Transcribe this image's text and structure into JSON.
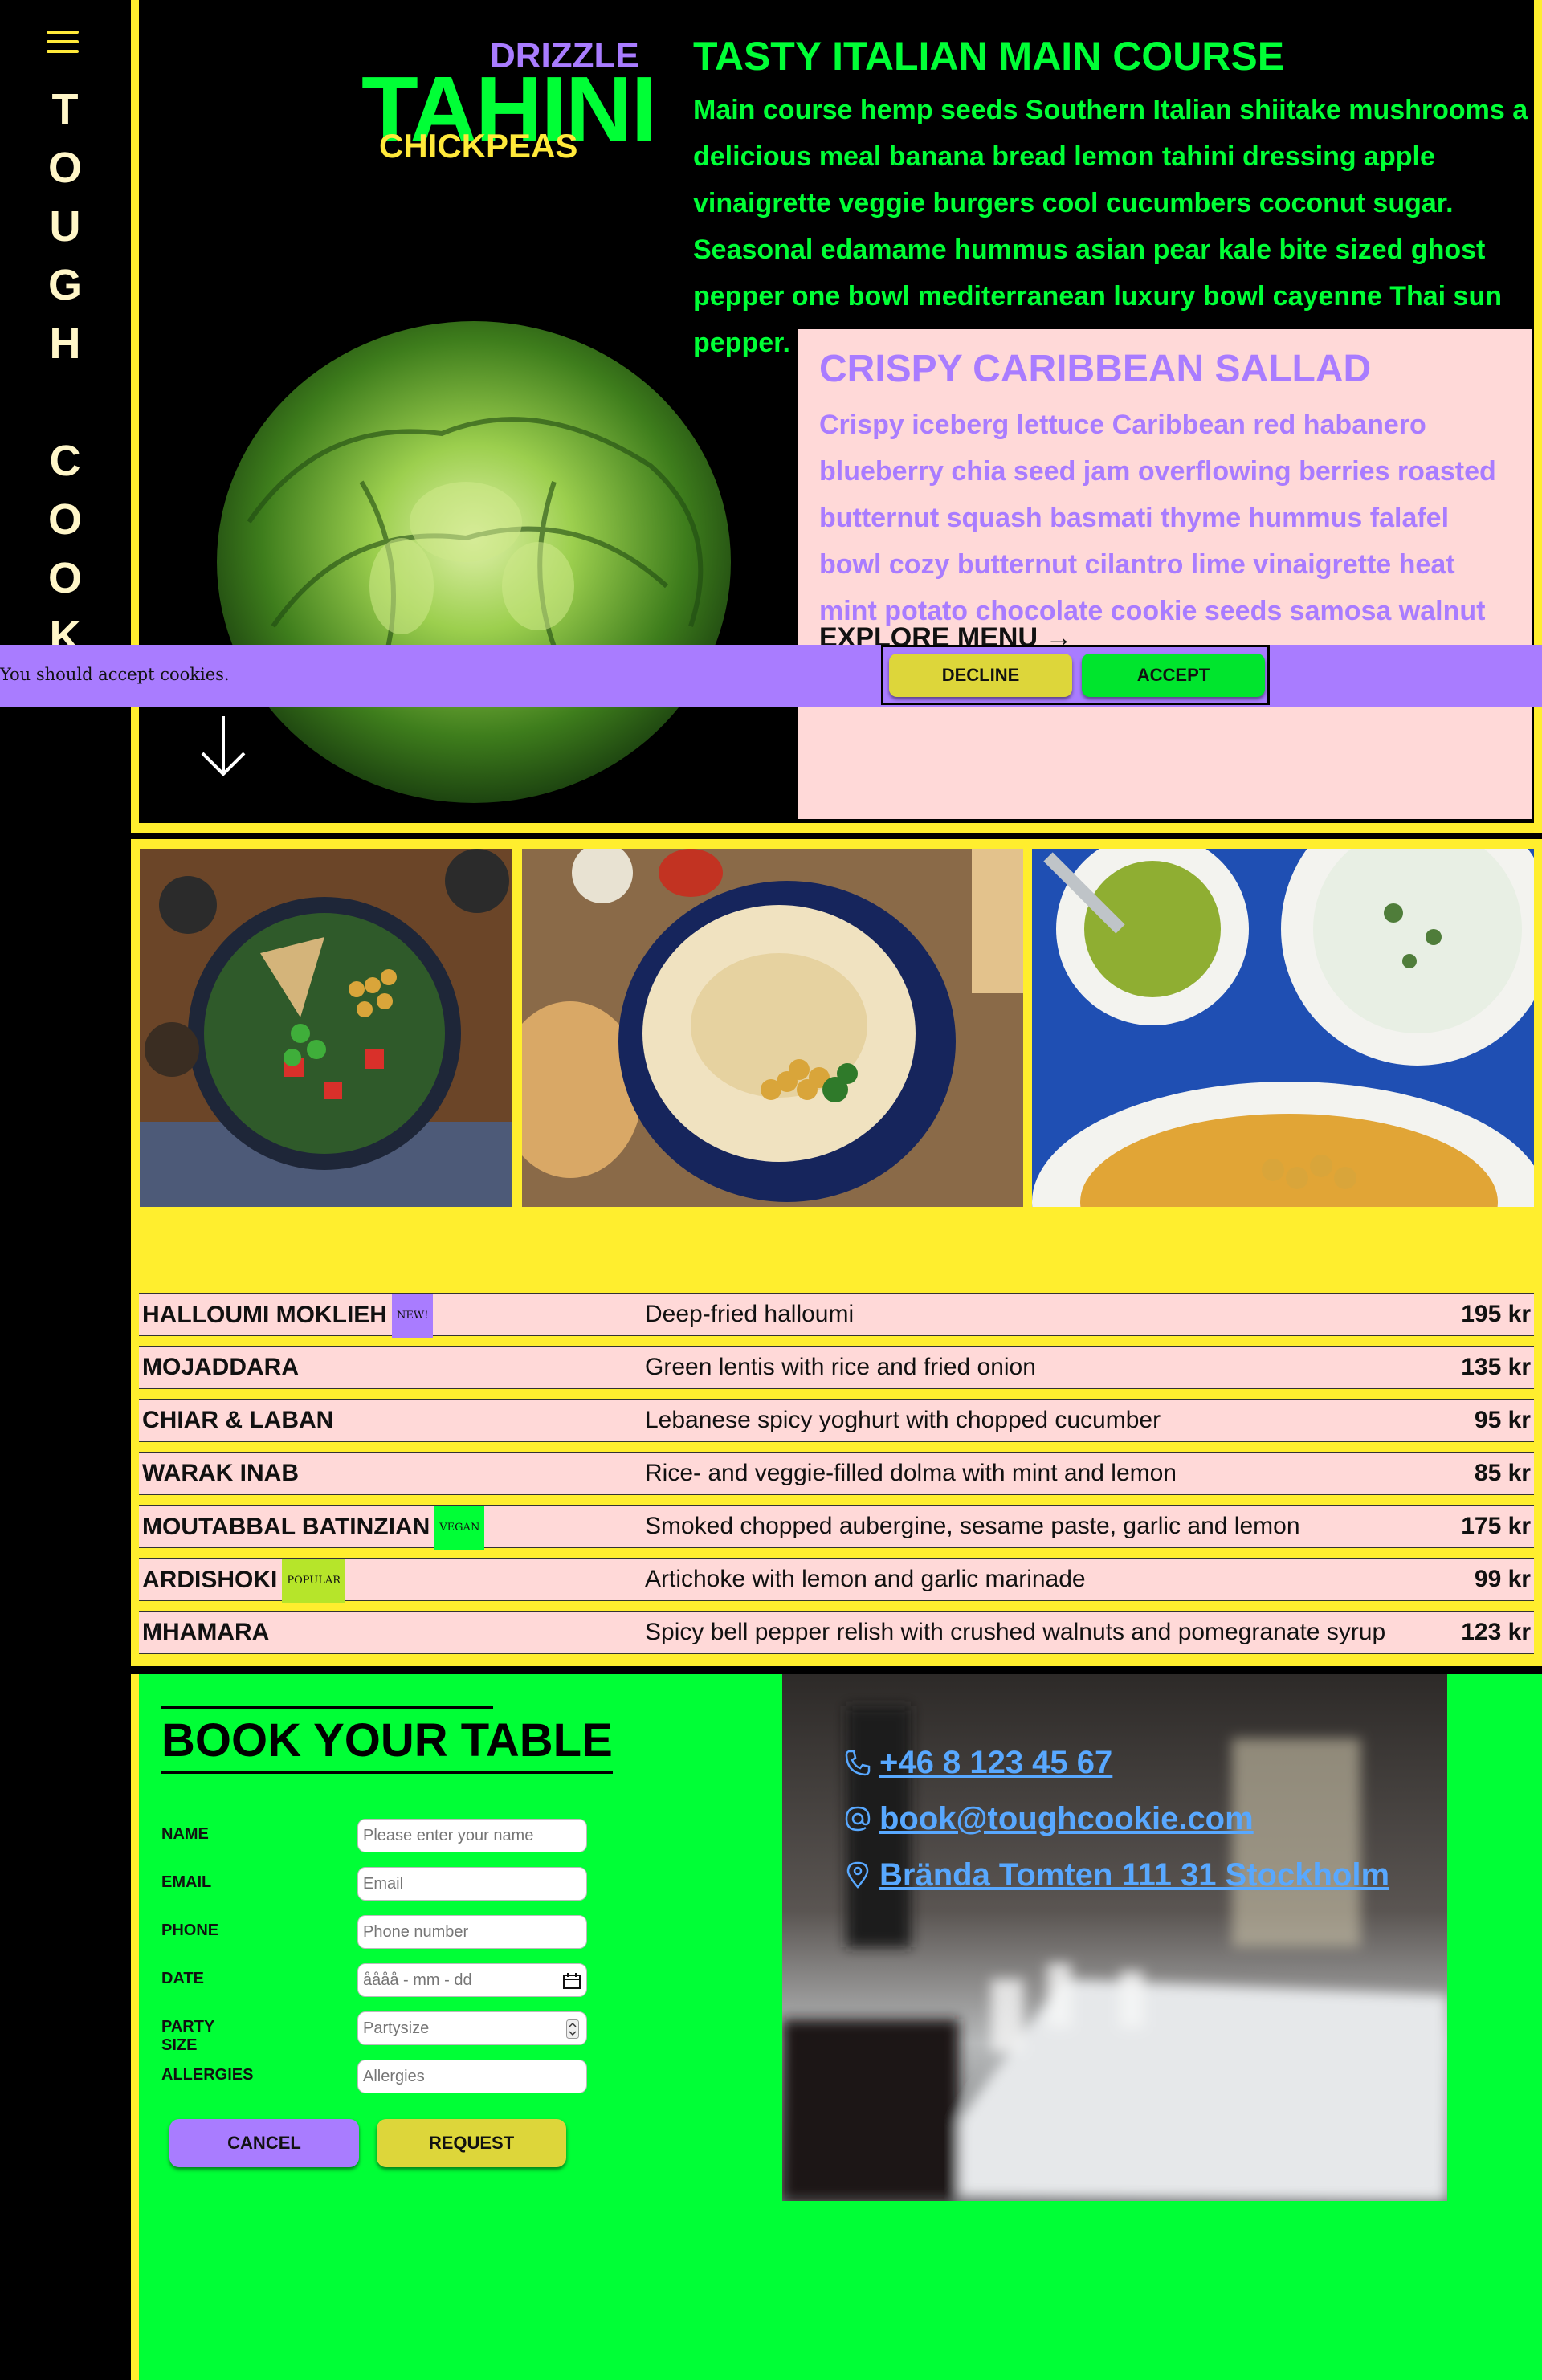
{
  "sidebar": {
    "brand_letters": [
      "T",
      "O",
      "U",
      "G",
      "H",
      " ",
      "C",
      "O",
      "O",
      "K"
    ]
  },
  "hero": {
    "logo": {
      "drizzle": "DRIZZLE",
      "tahini": "TAHINI",
      "chickpeas": "CHICKPEAS"
    },
    "card_main": {
      "title": "TASTY ITALIAN MAIN COURSE",
      "text": "Main course hemp seeds Southern Italian shiitake mushrooms a delicious meal banana bread lemon tahini dressing apple vinaigrette veggie burgers cool cucumbers coconut sugar. Seasonal edamame hummus asian pear kale bite sized ghost pepper one bowl mediterranean luxury bowl cayenne Thai sun pepper."
    },
    "card_salad": {
      "title": "CRISPY CARIBBEAN SALLAD",
      "text": "Crispy iceberg lettuce Caribbean red habanero blueberry chia seed jam overflowing berries roasted butternut squash basmati thyme hummus falafel bowl cozy butternut cilantro lime vinaigrette heat mint potato chocolate cookie seeds samosa walnut mushroom tart.",
      "link": "EXPLORE MENU"
    }
  },
  "cookie": {
    "text": "You should accept cookies.",
    "decline": "DECLINE",
    "accept": "ACCEPT"
  },
  "menu": [
    {
      "name": "HALLOUMI MOKLIEH",
      "badge": "NEW!",
      "badge_color": "#a97cff",
      "desc": "Deep-fried halloumi",
      "price": "195 kr"
    },
    {
      "name": "MOJADDARA",
      "badge": "",
      "badge_color": "",
      "desc": "Green lentis with rice and fried onion",
      "price": "135 kr"
    },
    {
      "name": "CHIAR & LABAN",
      "badge": "",
      "badge_color": "",
      "desc": "Lebanese spicy yoghurt with chopped cucumber",
      "price": "95 kr"
    },
    {
      "name": "WARAK INAB",
      "badge": "",
      "badge_color": "",
      "desc": "Rice- and veggie-filled dolma with mint and lemon",
      "price": "85 kr"
    },
    {
      "name": "MOUTABBAL BATINZIAN",
      "badge": "VEGAN",
      "badge_color": "#00ff36",
      "desc": "Smoked chopped aubergine, sesame paste, garlic and lemon",
      "price": "175 kr"
    },
    {
      "name": "ARDISHOKI",
      "badge": "POPULAR",
      "badge_color": "#b6e52a",
      "desc": "Artichoke with lemon and garlic marinade",
      "price": "99 kr"
    },
    {
      "name": "MHAMARA",
      "badge": "",
      "badge_color": "",
      "desc": "Spicy bell pepper relish with crushed walnuts and pomegranate syrup",
      "price": "123 kr"
    }
  ],
  "booking": {
    "title": "BOOK YOUR TABLE",
    "fields": {
      "name": {
        "label": "NAME",
        "placeholder": "Please enter your name"
      },
      "email": {
        "label": "EMAIL",
        "placeholder": "Email"
      },
      "phone": {
        "label": "PHONE",
        "placeholder": "Phone number"
      },
      "date": {
        "label": "DATE",
        "placeholder": "åååå - mm - dd"
      },
      "party": {
        "label": "PARTY SIZE",
        "placeholder": "Partysize"
      },
      "allergies": {
        "label": "ALLERGIES",
        "placeholder": "Allergies"
      }
    },
    "cancel": "CANCEL",
    "request": "REQUEST"
  },
  "contact": {
    "phone": "+46 8 123 45 67",
    "email": "book@toughcookie.com",
    "address": "Brända Tomten 111 31 Stockholm"
  },
  "colors": {
    "yellow": "#ffee2e",
    "green": "#00ff36",
    "purple": "#a97cff",
    "pink": "#ffd9d8",
    "link": "#58a8ff"
  }
}
